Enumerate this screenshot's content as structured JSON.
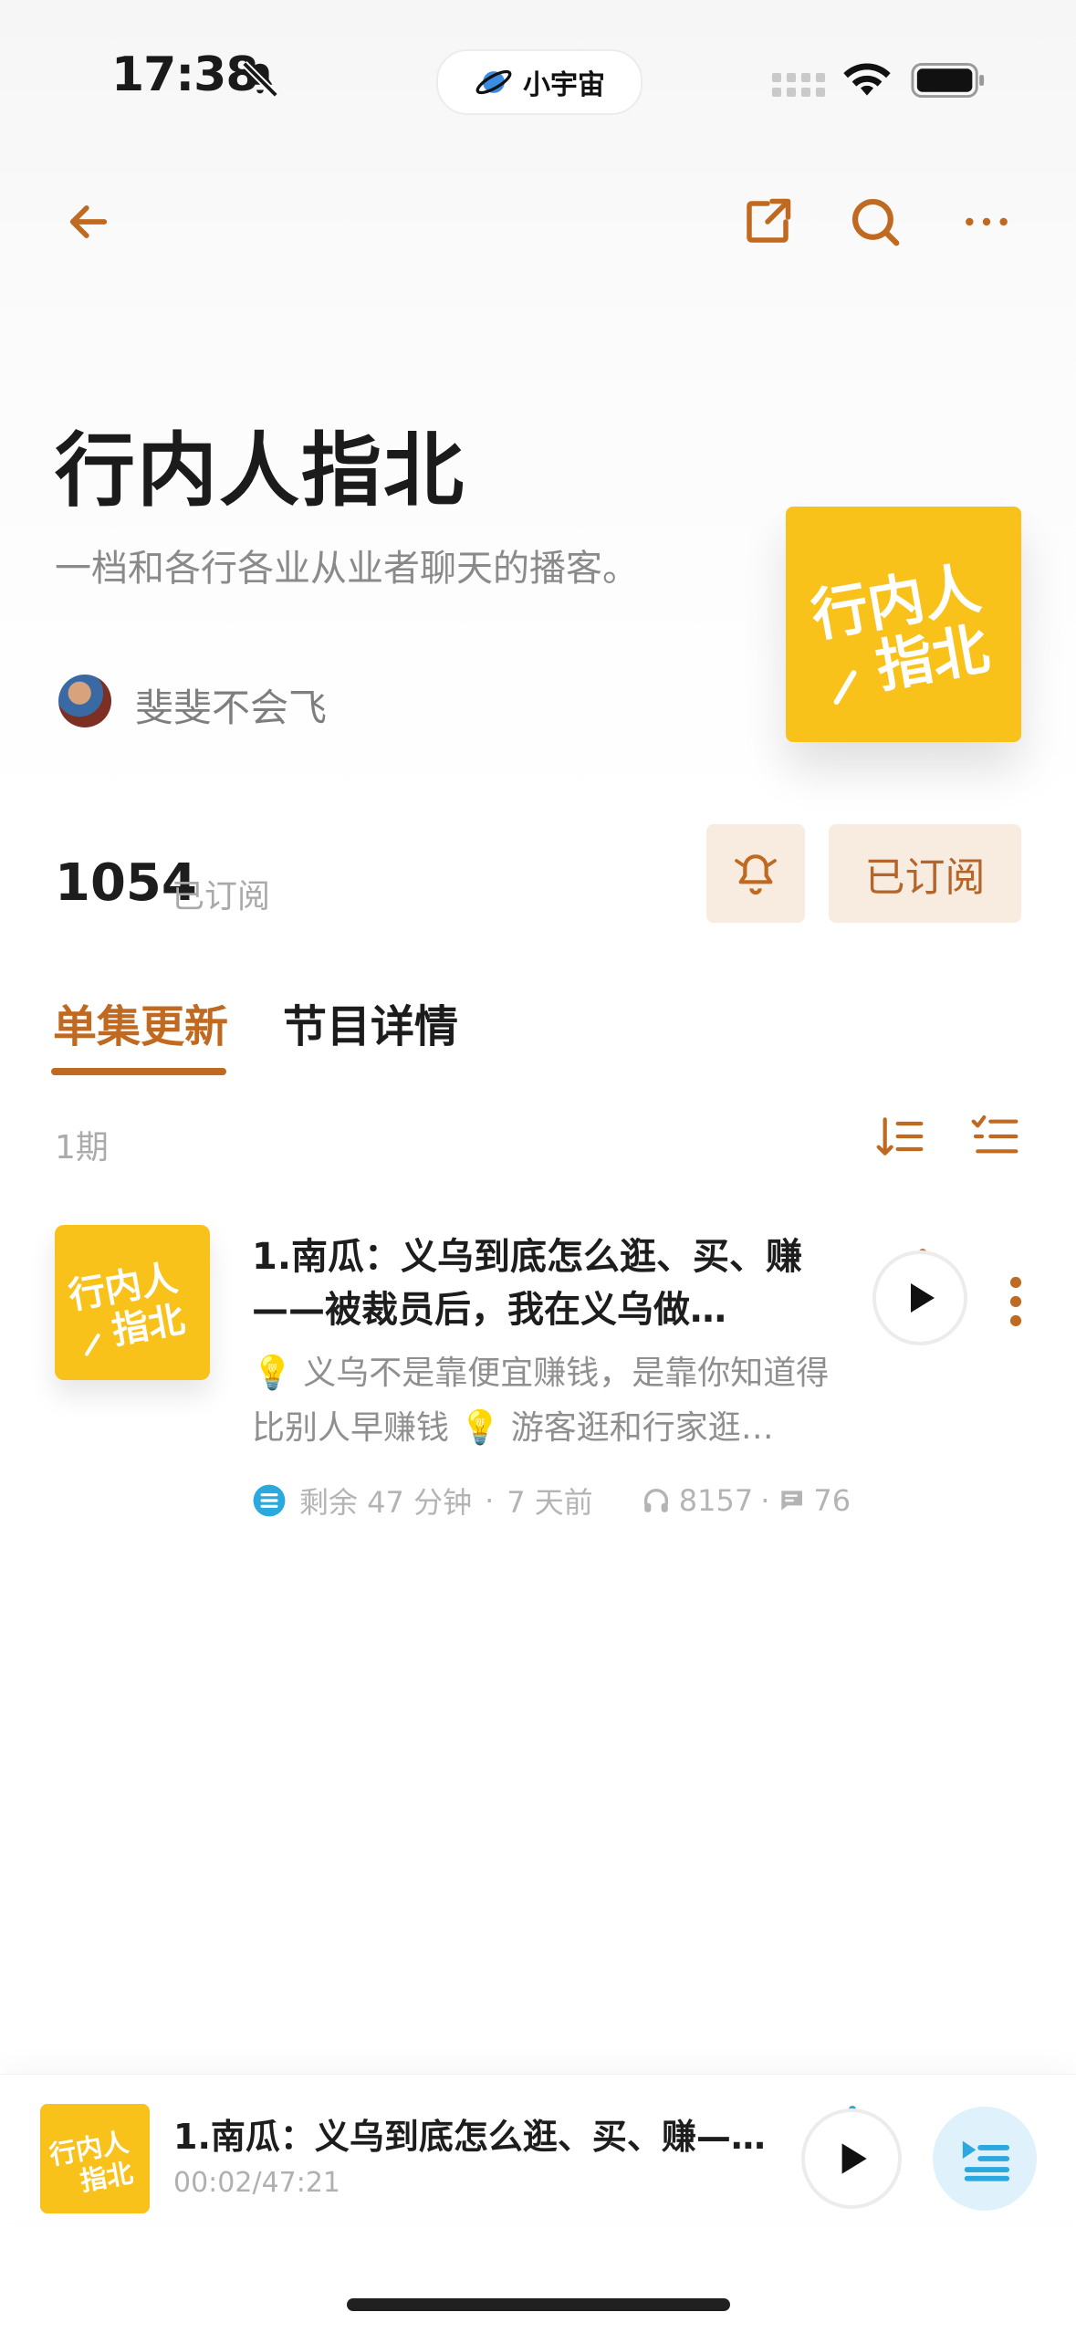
{
  "status_bar": {
    "time": "17:38",
    "island_label": "小宇宙"
  },
  "nav": {
    "back": "arrow-left-icon",
    "share": "share-icon",
    "search": "search-icon",
    "more": "more-horizontal-icon"
  },
  "podcast": {
    "title": "行内人指北",
    "description": "一档和各行各业从业者聊天的播客。",
    "author": "斐斐不会飞",
    "cover_text_line1": "行内人",
    "cover_text_line2": "指北",
    "subscriber_count": "1054",
    "subscriber_label": "已订阅",
    "subscribe_button": "已订阅"
  },
  "tabs": [
    {
      "label": "单集更新",
      "active": true
    },
    {
      "label": "节目详情",
      "active": false
    }
  ],
  "episode_list": {
    "count_label": "1期",
    "episodes": [
      {
        "title": "1.南瓜：义乌到底怎么逛、买、赚——被裁员后，我在义乌做…",
        "description": "💡 义乌不是靠便宜赚钱，是靠你知道得比别人早赚钱 💡 游客逛和行家逛…",
        "remaining": "剩余 47 分钟",
        "sep": "·",
        "published": "7 天前",
        "plays": "8157",
        "comments": "76"
      }
    ]
  },
  "player": {
    "title": "1.南瓜：义乌到底怎么逛、买、赚—…",
    "time": "00:02/47:21"
  },
  "colors": {
    "accent": "#bf6a20",
    "cover_yellow": "#f9c21b",
    "button_bg": "#f8ece0",
    "player_list_bg": "#dff1fb",
    "player_list_icon": "#2ba8de"
  }
}
